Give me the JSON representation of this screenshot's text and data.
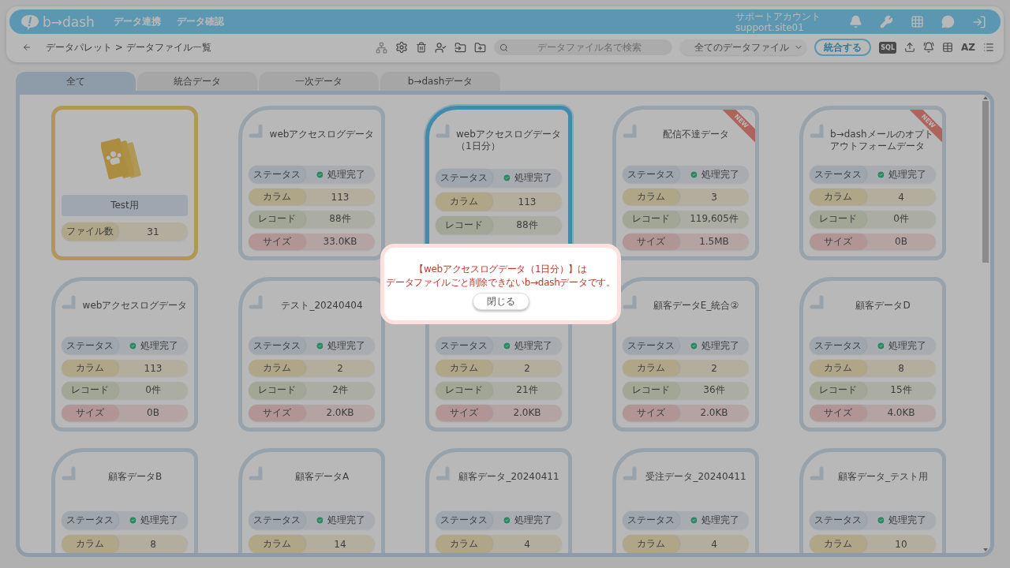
{
  "header": {
    "logo": "b→dash",
    "nav": [
      "データ連携",
      "データ確認"
    ],
    "account_name": "サポートアカウント",
    "account_id": "support.site01"
  },
  "toolbar": {
    "breadcrumb": "データパレット > データファイル一覧",
    "search": {
      "placeholder": "データファイル名で検索"
    },
    "filter": "全てのデータファイル",
    "merge_button": "統合する",
    "sql": "SQL",
    "sort": "AZ"
  },
  "tabs": [
    {
      "label": "全て",
      "selected": true
    },
    {
      "label": "統合データ",
      "selected": false
    },
    {
      "label": "一次データ",
      "selected": false
    },
    {
      "label": "b→dashデータ",
      "selected": false
    }
  ],
  "cards": [
    {
      "kind": "folder",
      "title": "Test用",
      "rows": [
        {
          "kind": "count",
          "label": "ファイル数",
          "value": "31"
        }
      ]
    },
    {
      "kind": "file",
      "title": "webアクセスログデータ",
      "selected": false,
      "new": false,
      "rows": [
        {
          "kind": "status",
          "label": "ステータス",
          "value": "処理完了"
        },
        {
          "kind": "column",
          "label": "カラム",
          "value": "113"
        },
        {
          "kind": "record",
          "label": "レコード",
          "value": "88件"
        },
        {
          "kind": "size",
          "label": "サイズ",
          "value": "33.0KB"
        }
      ]
    },
    {
      "kind": "file",
      "title": "webアクセスログデータ（1日分）",
      "selected": true,
      "new": false,
      "rows": [
        {
          "kind": "status",
          "label": "ステータス",
          "value": "処理完了"
        },
        {
          "kind": "column",
          "label": "カラム",
          "value": "113"
        },
        {
          "kind": "record",
          "label": "レコード",
          "value": "88件"
        }
      ]
    },
    {
      "kind": "file",
      "title": "配信不達データ",
      "selected": false,
      "new": true,
      "badge": "NEW",
      "rows": [
        {
          "kind": "status",
          "label": "ステータス",
          "value": "処理完了"
        },
        {
          "kind": "column",
          "label": "カラム",
          "value": "3"
        },
        {
          "kind": "record",
          "label": "レコード",
          "value": "119,605件"
        },
        {
          "kind": "size",
          "label": "サイズ",
          "value": "1.5MB"
        }
      ]
    },
    {
      "kind": "file",
      "title": "b→dashメールのオプトアウトフォームデータ",
      "selected": false,
      "new": true,
      "badge": "NEW",
      "rows": [
        {
          "kind": "status",
          "label": "ステータス",
          "value": "処理完了"
        },
        {
          "kind": "column",
          "label": "カラム",
          "value": "4"
        },
        {
          "kind": "record",
          "label": "レコード",
          "value": "0件"
        },
        {
          "kind": "size",
          "label": "サイズ",
          "value": "0B"
        }
      ]
    },
    {
      "kind": "file",
      "title": "webアクセスログデータ",
      "selected": false,
      "new": false,
      "rows": [
        {
          "kind": "status",
          "label": "ステータス",
          "value": "処理完了"
        },
        {
          "kind": "column",
          "label": "カラム",
          "value": "113"
        },
        {
          "kind": "record",
          "label": "レコード",
          "value": "0件"
        },
        {
          "kind": "size",
          "label": "サイズ",
          "value": "0B"
        }
      ]
    },
    {
      "kind": "file",
      "title": "テスト_20240404",
      "selected": false,
      "new": false,
      "rows": [
        {
          "kind": "status",
          "label": "ステータス",
          "value": "処理完了"
        },
        {
          "kind": "column",
          "label": "カラム",
          "value": "2"
        },
        {
          "kind": "record",
          "label": "レコード",
          "value": "2件"
        },
        {
          "kind": "size",
          "label": "サイズ",
          "value": "2.0KB"
        }
      ]
    },
    {
      "kind": "file",
      "selected": false,
      "new": false,
      "rows": [
        {
          "kind": "status",
          "label": "ステータス",
          "value": "処理完了"
        },
        {
          "kind": "column",
          "label": "カラム",
          "value": "2"
        },
        {
          "kind": "record",
          "label": "レコード",
          "value": "21件"
        },
        {
          "kind": "size",
          "label": "サイズ",
          "value": "2.0KB"
        }
      ]
    },
    {
      "kind": "file",
      "title": "顧客データE_統合②",
      "selected": false,
      "new": false,
      "rows": [
        {
          "kind": "status",
          "label": "ステータス",
          "value": "処理完了"
        },
        {
          "kind": "column",
          "label": "カラム",
          "value": "2"
        },
        {
          "kind": "record",
          "label": "レコード",
          "value": "36件"
        },
        {
          "kind": "size",
          "label": "サイズ",
          "value": "2.0KB"
        }
      ]
    },
    {
      "kind": "file",
      "title": "顧客データD",
      "selected": false,
      "new": false,
      "rows": [
        {
          "kind": "status",
          "label": "ステータス",
          "value": "処理完了"
        },
        {
          "kind": "column",
          "label": "カラム",
          "value": "8"
        },
        {
          "kind": "record",
          "label": "レコード",
          "value": "15件"
        },
        {
          "kind": "size",
          "label": "サイズ",
          "value": "4.0KB"
        }
      ]
    },
    {
      "kind": "file",
      "title": "顧客データB",
      "selected": false,
      "new": false,
      "rows": [
        {
          "kind": "status",
          "label": "ステータス",
          "value": "処理完了"
        },
        {
          "kind": "column",
          "label": "カラム",
          "value": "8"
        }
      ]
    },
    {
      "kind": "file",
      "title": "顧客データA",
      "selected": false,
      "new": false,
      "rows": [
        {
          "kind": "status",
          "label": "ステータス",
          "value": "処理完了"
        },
        {
          "kind": "column",
          "label": "カラム",
          "value": "14"
        }
      ]
    },
    {
      "kind": "file",
      "title": "顧客データ_20240411",
      "selected": false,
      "new": false,
      "rows": [
        {
          "kind": "status",
          "label": "ステータス",
          "value": "処理完了"
        },
        {
          "kind": "column",
          "label": "カラム",
          "value": "4"
        }
      ]
    },
    {
      "kind": "file",
      "title": "受注データ_20240411",
      "selected": false,
      "new": false,
      "rows": [
        {
          "kind": "status",
          "label": "ステータス",
          "value": "処理完了"
        },
        {
          "kind": "column",
          "label": "カラム",
          "value": "4"
        }
      ]
    },
    {
      "kind": "file",
      "title": "顧客データ_テスト用",
      "selected": false,
      "new": false,
      "rows": [
        {
          "kind": "status",
          "label": "ステータス",
          "value": "処理完了"
        },
        {
          "kind": "column",
          "label": "カラム",
          "value": "10"
        }
      ]
    }
  ],
  "dialog": {
    "lines": [
      "【webアクセスログデータ（1日分）】は",
      "データファイルごと削除できないb→dashデータです。"
    ],
    "button": "閉じる"
  }
}
